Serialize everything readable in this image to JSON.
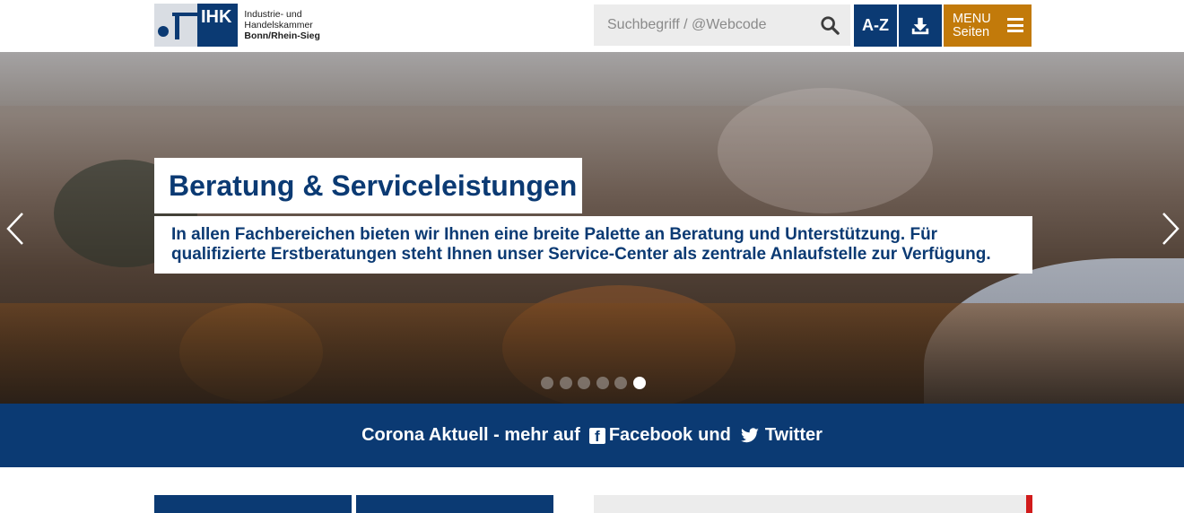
{
  "header": {
    "logo": {
      "mark": "IHK",
      "line1": "Industrie- und Handelskammer",
      "line2": "Bonn/Rhein-Sieg"
    },
    "search": {
      "placeholder": "Suchbegriff / @Webcode",
      "value": ""
    },
    "az_label": "A-Z",
    "menu_label_1": "MENU",
    "menu_label_2": "Seiten"
  },
  "hero": {
    "title": "Beratung & Serviceleistungen",
    "description": "In allen Fachbereichen bieten wir Ihnen eine breite Palette an Beratung und Unterstützung. Für qualifizierte Erstberatungen steht Ihnen unser Service-Center als zentrale Anlaufstelle zur Verfügung.",
    "slides_total": 6,
    "active_slide": 6
  },
  "corona": {
    "text_1": "Corona Aktuell - mehr auf",
    "facebook_label": "Facebook",
    "text_2": "und",
    "twitter_label": "Twitter"
  },
  "colors": {
    "brand_blue": "#0b3a73",
    "menu_orange": "#c27a0a",
    "accent_red": "#d11b1b"
  }
}
